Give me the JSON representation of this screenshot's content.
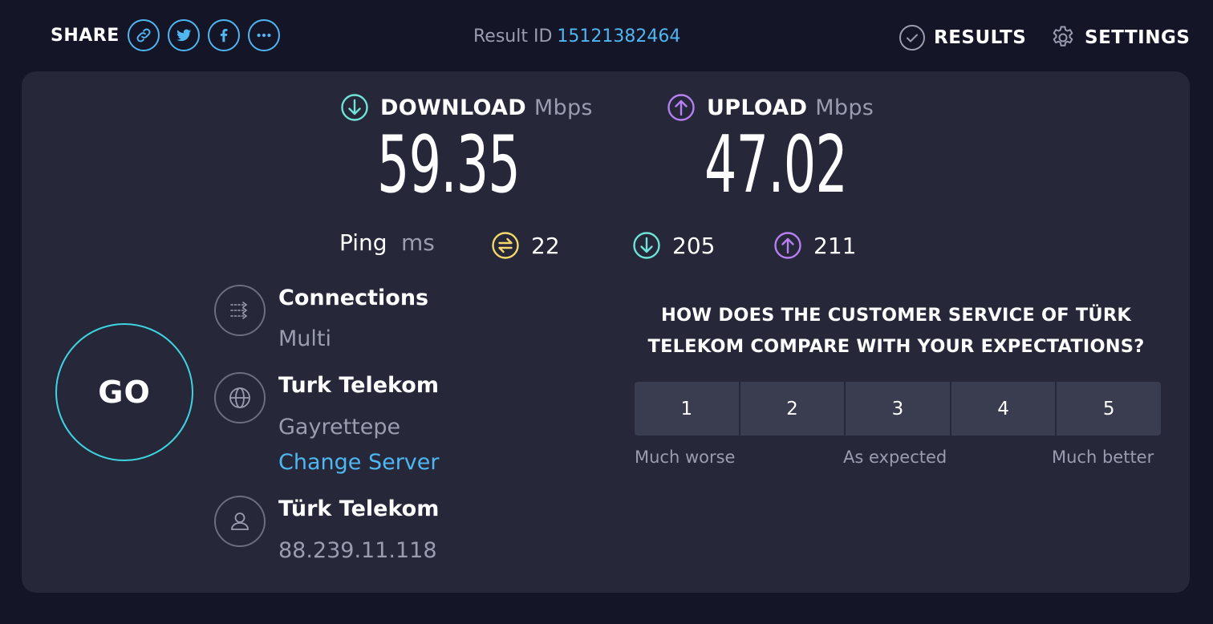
{
  "header": {
    "share_label": "SHARE",
    "share_buttons": [
      {
        "icon": "link-icon"
      },
      {
        "icon": "twitter-icon"
      },
      {
        "icon": "facebook-icon"
      },
      {
        "icon": "more-icon"
      }
    ],
    "result_id_label": "Result ID",
    "result_id": "15121382464",
    "results_label": "RESULTS",
    "settings_label": "SETTINGS"
  },
  "metrics": {
    "download": {
      "label": "DOWNLOAD",
      "unit": "Mbps",
      "value": "59.35",
      "color": "#6fe3d8"
    },
    "upload": {
      "label": "UPLOAD",
      "unit": "Mbps",
      "value": "47.02",
      "color": "#b680f3"
    }
  },
  "ping": {
    "label": "Ping",
    "unit": "ms",
    "idle": "22",
    "download": "205",
    "upload": "211",
    "idle_color": "#f4d86b"
  },
  "go_label": "GO",
  "connection": {
    "connections_title": "Connections",
    "connections_value": "Multi",
    "server_name": "Turk Telekom",
    "server_location": "Gayrettepe",
    "change_server_label": "Change Server",
    "isp_name": "Türk Telekom",
    "ip_address": "88.239.11.118"
  },
  "survey": {
    "question_line1": "HOW DOES THE CUSTOMER SERVICE OF TÜRK",
    "question_line2": "TELEKOM COMPARE WITH YOUR EXPECTATIONS?",
    "options": [
      "1",
      "2",
      "3",
      "4",
      "5"
    ],
    "label_low": "Much worse",
    "label_mid": "As expected",
    "label_high": "Much better"
  },
  "colors": {
    "accent_blue": "#50b6f2",
    "go_ring": "#3fd3e0",
    "background": "#141526",
    "card": "#262839"
  }
}
